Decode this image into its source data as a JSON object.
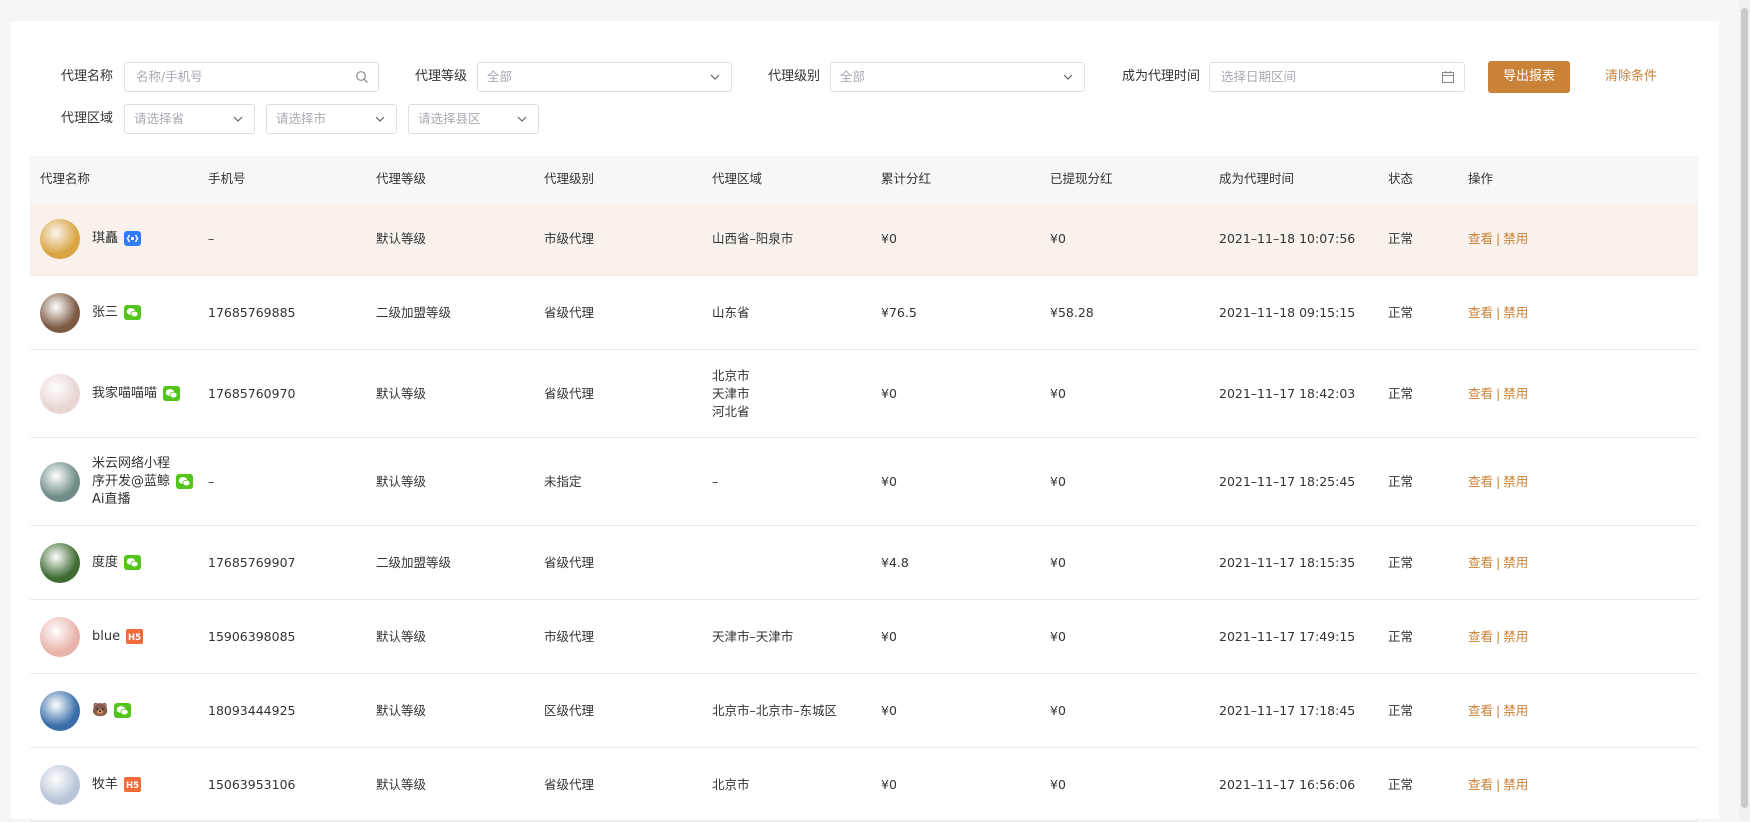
{
  "filters": {
    "agent_name_label": "代理名称",
    "agent_name_placeholder": "名称/手机号",
    "agent_grade_label": "代理等级",
    "agent_grade_value": "全部",
    "agent_level_label": "代理级别",
    "agent_level_value": "全部",
    "join_time_label": "成为代理时间",
    "join_time_placeholder": "选择日期区间",
    "export_button": "导出报表",
    "clear_button": "清除条件",
    "region_label": "代理区域",
    "province_placeholder": "请选择省",
    "city_placeholder": "请选择市",
    "county_placeholder": "请选择县区"
  },
  "table": {
    "headers": [
      "代理名称",
      "手机号",
      "代理等级",
      "代理级别",
      "代理区域",
      "累计分红",
      "已提现分红",
      "成为代理时间",
      "状态",
      "操作"
    ],
    "op_view": "查看",
    "op_sep": "|",
    "op_disable": "禁用",
    "rows": [
      {
        "name": "琪矗",
        "badge": "miniapp",
        "phone": "–",
        "grade": "默认等级",
        "level": "市级代理",
        "area": [
          "山西省–阳泉市"
        ],
        "total": "¥0",
        "withdrawn": "¥0",
        "time": "2021–11–18 10:07:56",
        "status": "正常",
        "avatar_color": "#d9a441"
      },
      {
        "name": "张三",
        "badge": "wechat",
        "phone": "17685769885",
        "grade": "二级加盟等级",
        "level": "省级代理",
        "area": [
          "山东省"
        ],
        "total": "¥76.5",
        "withdrawn": "¥58.28",
        "time": "2021–11–18 09:15:15",
        "status": "正常",
        "avatar_color": "#7d5a44"
      },
      {
        "name": "我家喵喵喵",
        "badge": "wechat",
        "phone": "17685760970",
        "grade": "默认等级",
        "level": "省级代理",
        "area": [
          "北京市",
          "天津市",
          "河北省"
        ],
        "total": "¥0",
        "withdrawn": "¥0",
        "time": "2021–11–17 18:42:03",
        "status": "正常",
        "avatar_color": "#e7d6d2"
      },
      {
        "name": "米云网络小程序开发@蓝鲸Ai直播",
        "name_lines": [
          "米云网络小程",
          "序开发@蓝鲸",
          "Ai直播"
        ],
        "badge": "wechat",
        "phone": "–",
        "grade": "默认等级",
        "level": "未指定",
        "area": [
          "–"
        ],
        "total": "¥0",
        "withdrawn": "¥0",
        "time": "2021–11–17 18:25:45",
        "status": "正常",
        "avatar_color": "#6f8c88"
      },
      {
        "name": "度度",
        "badge": "wechat",
        "phone": "17685769907",
        "grade": "二级加盟等级",
        "level": "省级代理",
        "area": [
          ""
        ],
        "total": "¥4.8",
        "withdrawn": "¥0",
        "time": "2021–11–17 18:15:35",
        "status": "正常",
        "avatar_color": "#3f6b33"
      },
      {
        "name": "blue",
        "badge": "h5",
        "phone": "15906398085",
        "grade": "默认等级",
        "level": "市级代理",
        "area": [
          "天津市–天津市"
        ],
        "total": "¥0",
        "withdrawn": "¥0",
        "time": "2021–11–17 17:49:15",
        "status": "正常",
        "avatar_color": "#e8b3ab"
      },
      {
        "name": "🐻",
        "badge": "wechat",
        "phone": "18093444925",
        "grade": "默认等级",
        "level": "区级代理",
        "area": [
          "北京市–北京市–东城区"
        ],
        "total": "¥0",
        "withdrawn": "¥0",
        "time": "2021–11–17 17:18:45",
        "status": "正常",
        "avatar_color": "#3a6ea8"
      },
      {
        "name": "牧羊",
        "badge": "h5",
        "phone": "15063953106",
        "grade": "默认等级",
        "level": "省级代理",
        "area": [
          "北京市"
        ],
        "total": "¥0",
        "withdrawn": "¥0",
        "time": "2021–11–17 16:56:06",
        "status": "正常",
        "avatar_color": "#b9c6d9"
      }
    ]
  },
  "colors": {
    "accent": "#c98237",
    "wechat": "#52c41a",
    "miniapp": "#2f7cf6",
    "h5": "#ef6b3a"
  }
}
